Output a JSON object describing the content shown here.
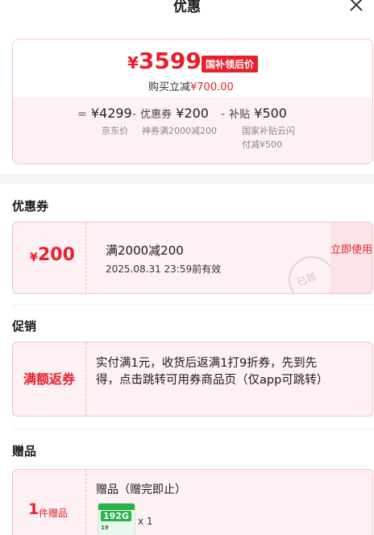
{
  "header": {
    "title": "优惠"
  },
  "price": {
    "currency": "¥",
    "final": "3599",
    "tag": "国补领后价",
    "saving_label": "购买立减",
    "saving_amount": "¥700.00",
    "calc": [
      {
        "op": "=",
        "label": "",
        "value": "¥4299",
        "sub": "京东价"
      },
      {
        "op": "-",
        "label": "优惠券",
        "value": "¥200",
        "sub": "神券满2000减200"
      },
      {
        "op": "-",
        "label": "补贴",
        "value": "¥500",
        "sub": "国家补贴云闪付减¥500"
      }
    ]
  },
  "coupons": {
    "title": "优惠券",
    "items": [
      {
        "currency": "¥",
        "amount": "200",
        "rule": "满2000减200",
        "expiry": "2025.08.31 23:59前有效",
        "button": "立即使用",
        "stamp": "已领"
      }
    ]
  },
  "promotion": {
    "title": "促销",
    "label": "满额返券",
    "text": "实付满1元，收货后返满1打9折券，先到先得，点击跳转可用券商品页（仅app可跳转）"
  },
  "gift": {
    "title": "赠品",
    "count": "1",
    "count_label": "件赠品",
    "item_title": "赠品（赠完即止）",
    "thumb_big": "192G",
    "thumb_small": "19",
    "quantity": "x 1"
  }
}
